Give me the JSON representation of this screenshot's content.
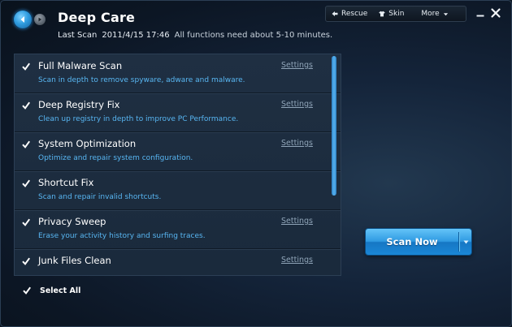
{
  "header": {
    "title": "Deep Care",
    "last_scan_label": "Last Scan",
    "last_scan_time": "2011/4/15 17:46",
    "duration_note": "All functions need about 5-10 minutes."
  },
  "toolbar": {
    "rescue": "Rescue",
    "skin": "Skin",
    "more": "More"
  },
  "items": [
    {
      "title": "Full Malware Scan",
      "desc": "Scan in depth to remove spyware, adware and malware.",
      "settings": "Settings",
      "checked": true
    },
    {
      "title": "Deep Registry Fix",
      "desc": "Clean up registry in depth to improve PC Performance.",
      "settings": "Settings",
      "checked": true
    },
    {
      "title": "System Optimization",
      "desc": "Optimize and repair system configuration.",
      "settings": "Settings",
      "checked": true
    },
    {
      "title": "Shortcut Fix",
      "desc": "Scan and repair invalid shortcuts.",
      "settings": "",
      "checked": true
    },
    {
      "title": "Privacy Sweep",
      "desc": "Erase your activity history and surfing traces.",
      "settings": "Settings",
      "checked": true
    },
    {
      "title": "Junk Files Clean",
      "desc": "",
      "settings": "Settings",
      "checked": true
    }
  ],
  "footer": {
    "select_all": "Select All",
    "select_all_checked": true
  },
  "scan_button": {
    "label": "Scan Now"
  },
  "colors": {
    "accent": "#2f9ae2",
    "description_text": "#58b6f2",
    "settings_link": "#8fa4b8"
  }
}
